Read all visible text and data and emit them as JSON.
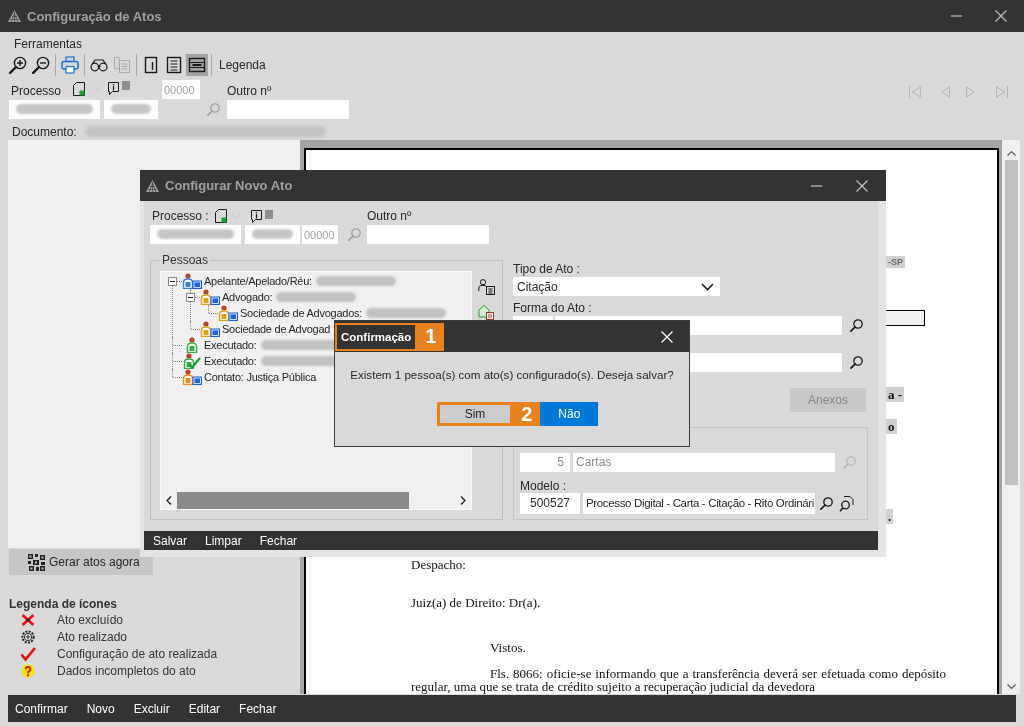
{
  "window": {
    "title": "Configuração de Atos"
  },
  "menu": [
    {
      "label": "Ferramentas"
    }
  ],
  "toolbar": {
    "groups": [
      [
        {
          "kind": "zoom-in",
          "disabled": false,
          "selected": false
        },
        {
          "kind": "zoom-out",
          "disabled": false,
          "selected": false
        }
      ],
      [
        {
          "kind": "print",
          "disabled": false,
          "selected": false
        }
      ],
      [
        {
          "kind": "find",
          "disabled": false,
          "selected": false
        },
        {
          "kind": "copy",
          "disabled": true,
          "selected": false
        }
      ],
      [
        {
          "kind": "page",
          "disabled": false,
          "selected": false
        },
        {
          "kind": "page-lines",
          "disabled": false,
          "selected": false
        },
        {
          "kind": "page-fit",
          "disabled": false,
          "selected": true
        }
      ]
    ],
    "legend_button": "Legenda"
  },
  "processo": {
    "label": "Processo",
    "fields": [
      {
        "redacted": true
      },
      {
        "redacted": true
      }
    ],
    "number": {
      "placeholder": "00000"
    },
    "other_label": "Outro nº"
  },
  "record_nav": {
    "disabled": true
  },
  "document": {
    "label": "Documento:",
    "redacted": true
  },
  "generate_button": {
    "label": "Gerar atos agora"
  },
  "icon_legend": {
    "title": "Legenda de ícones",
    "items": [
      {
        "kind": "deleted",
        "label": "Ato excluído"
      },
      {
        "kind": "done",
        "label": "Ato realizado"
      },
      {
        "kind": "configured",
        "label": "Configuração de ato realizada"
      },
      {
        "kind": "incomplete",
        "label": "Dados incompletos do ato"
      }
    ]
  },
  "footer_buttons": [
    "Confirmar",
    "Novo",
    "Excluir",
    "Editar",
    "Fechar"
  ],
  "document_page": {
    "fragments": [
      {
        "text": "-SP",
        "muted": true
      },
      {
        "text": "a -",
        "muted": false
      },
      {
        "text": "o",
        "muted": false
      },
      {
        "text": ".",
        "muted": false
      }
    ],
    "lines": [
      {
        "kind": "flush",
        "text": "Despacho:"
      },
      {
        "kind": "flush",
        "text": "Juiz(a) de Direito: Dr(a)."
      },
      {
        "kind": "indented",
        "text": "Vistos."
      },
      {
        "kind": "indented",
        "text": "Fls. 8066: oficie-se informando que a transferência deverá ser efetuada como depósito regular, uma que se trata de crédito sujeito a recuperação judicial da devedora"
      }
    ]
  },
  "config_dialog": {
    "title": "Configurar Novo Ato",
    "processo": {
      "label": "Processo :",
      "fields": [
        {
          "redacted": true
        },
        {
          "redacted": true
        }
      ],
      "number": {
        "placeholder": "00000"
      },
      "other_label": "Outro nº"
    },
    "people": {
      "title": "Pessoas",
      "tree": [
        {
          "label": "Apelante/Apelado/Réu:",
          "kind": "party",
          "redacted": true,
          "expanded": true,
          "children": [
            {
              "label": "Advogado:",
              "kind": "lawyer",
              "redacted": true,
              "expanded": true,
              "children": [
                {
                  "label": "Sociedade de Advogados:",
                  "kind": "lawyer",
                  "redacted": true
                }
              ]
            },
            {
              "label": "Sociedade de Advogad",
              "kind": "lawyer",
              "redacted": false
            }
          ]
        },
        {
          "label": "Executado:",
          "kind": "debtor",
          "redacted": true
        },
        {
          "label": "Executado:",
          "kind": "debtor-done",
          "redacted": true
        },
        {
          "label": "Contato: Justiça Pública",
          "kind": "contact",
          "redacted": false
        }
      ]
    },
    "act_type": {
      "label": "Tipo de Ato :",
      "value": "Citação"
    },
    "act_form": {
      "label": "Forma do Ato :"
    },
    "attachments_button": {
      "label": "Anexos",
      "disabled": true
    },
    "category": {
      "code": "5",
      "value": "Cartas",
      "disabled": true
    },
    "model": {
      "label": "Modelo :",
      "code": "500527",
      "value": "Processo Digital - Carta - Citação - Rito Ordinári"
    },
    "buttons": [
      "Salvar",
      "Limpar",
      "Fechar"
    ]
  },
  "confirm_dialog": {
    "title": "Confirmação",
    "title_highlighted": true,
    "title_callout": "1",
    "message": "Existem 1 pessoa(s) com ato(s) configurado(s). Deseja salvar?",
    "buttons": [
      {
        "label": "Sim",
        "highlighted": true,
        "focused": false,
        "callout": "2"
      },
      {
        "label": "Não",
        "highlighted": false,
        "focused": true
      }
    ]
  }
}
